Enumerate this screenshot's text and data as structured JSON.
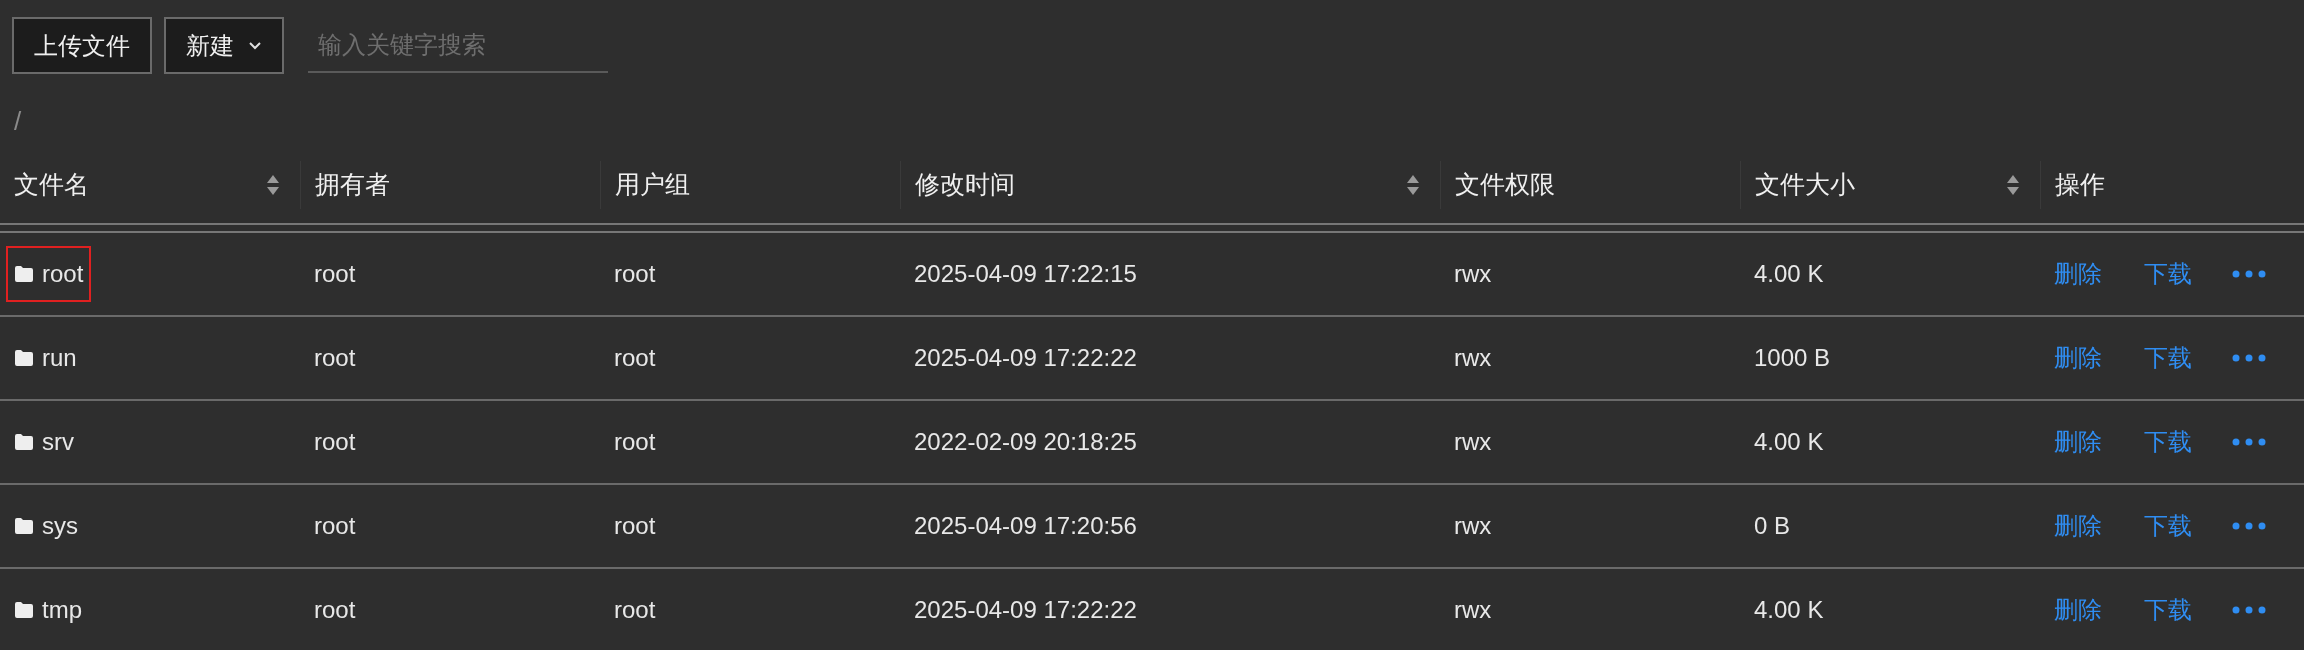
{
  "toolbar": {
    "upload_button": "上传文件",
    "new_button": "新建",
    "search": {
      "placeholder": "输入关键字搜索"
    }
  },
  "path": "/",
  "table": {
    "columns": [
      {
        "label": "文件名",
        "sortable": true
      },
      {
        "label": "拥有者",
        "sortable": false
      },
      {
        "label": "用户组",
        "sortable": false
      },
      {
        "label": "修改时间",
        "sortable": true
      },
      {
        "label": "文件权限",
        "sortable": false
      },
      {
        "label": "文件大小",
        "sortable": true
      },
      {
        "label": "操作",
        "sortable": false
      }
    ],
    "rows": [
      {
        "name": "root",
        "owner": "root",
        "group": "root",
        "modified": "2025-04-09 17:22:15",
        "permissions": "rwx",
        "size": "4.00 K",
        "outlined": true,
        "actions": [
          "删除",
          "下载"
        ]
      },
      {
        "name": "run",
        "owner": "root",
        "group": "root",
        "modified": "2025-04-09 17:22:22",
        "permissions": "rwx",
        "size": "1000 B",
        "outlined": false,
        "actions": [
          "删除",
          "下载"
        ]
      },
      {
        "name": "srv",
        "owner": "root",
        "group": "root",
        "modified": "2022-02-09 20:18:25",
        "permissions": "rwx",
        "size": "4.00 K",
        "outlined": false,
        "actions": [
          "删除",
          "下载"
        ]
      },
      {
        "name": "sys",
        "owner": "root",
        "group": "root",
        "modified": "2025-04-09 17:20:56",
        "permissions": "rwx",
        "size": "0 B",
        "outlined": false,
        "actions": [
          "删除",
          "下载"
        ]
      },
      {
        "name": "tmp",
        "owner": "root",
        "group": "root",
        "modified": "2025-04-09 17:22:22",
        "permissions": "rwx",
        "size": "4.00 K",
        "outlined": false,
        "actions": [
          "删除",
          "下载"
        ]
      }
    ]
  }
}
